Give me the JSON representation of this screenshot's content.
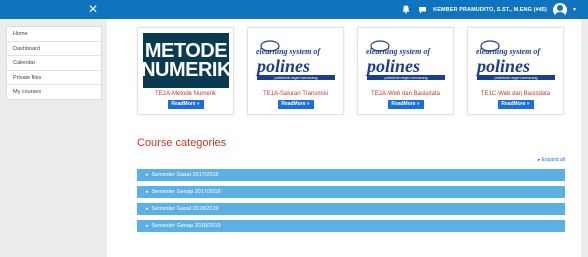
{
  "topbar": {
    "close_icon": "×",
    "username": "KEMBER PRAMUDITO, S.ST., M.ENG (#45)",
    "caret": "▾"
  },
  "sidebar": {
    "items": [
      {
        "label": "Home"
      },
      {
        "label": "Dashboard"
      },
      {
        "label": "Calendar"
      },
      {
        "label": "Private files"
      },
      {
        "label": "My courses"
      }
    ]
  },
  "courses": [
    {
      "title": "TE2A-Metode Numerik",
      "thumb_line1": "METODE",
      "thumb_line2": "NUMERIK",
      "button": "ReadMore »"
    },
    {
      "title": "TE1A-Saluran Transmisi",
      "button": "ReadMore »"
    },
    {
      "title": "TE2A-Web dan Basisdata",
      "button": "ReadMore »"
    },
    {
      "title": "TE1C-Web dan Basisdata",
      "button": "ReadMore »"
    }
  ],
  "logo": {
    "top": "elearning system of",
    "brand": "polines",
    "sub": "politeknik negeri semarang"
  },
  "categories": {
    "title": "Course categories",
    "expand_all": "Expand all",
    "items": [
      {
        "label": "Semester Gasal 2017/2018"
      },
      {
        "label": "Semester Genap 2017/2018"
      },
      {
        "label": "Semester Gasal 2018/2019"
      },
      {
        "label": "Semester Genap 2018/2019"
      }
    ]
  },
  "colors": {
    "topbar": "#0f74bd",
    "accent_red": "#c0392b",
    "button_blue": "#1b6fd6",
    "category_blue": "#5cb0e3"
  }
}
